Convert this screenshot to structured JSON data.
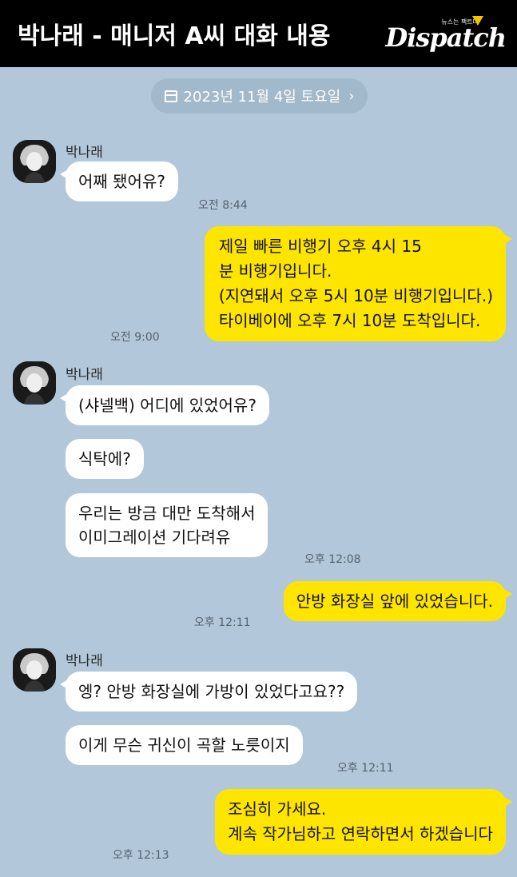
{
  "header": {
    "title": "박나래 - 매니저 A씨 대화 내용",
    "logo_tag": "뉴스는 팩트다",
    "logo_text": "Dispatch"
  },
  "date_pill": {
    "label": "2023년 11월 4일 토요일",
    "icon": "calendar-icon",
    "chevron": "›"
  },
  "messages": [
    {
      "sender": "박나래",
      "text": "어째 됐어유?",
      "time": "오전 8:44"
    },
    {
      "text_lines": [
        "제일 빠른 비행기 오후 4시 15",
        "분 비행기입니다.",
        "(지연돼서 오후 5시 10분 비행기입니다.)",
        "타이베이에 오후 7시 10분 도착입니다."
      ],
      "time": "오전 9:00"
    },
    {
      "sender": "박나래",
      "text": "(샤넬백) 어디에 있었어유?"
    },
    {
      "text": "식탁에?"
    },
    {
      "text_lines": [
        "우리는 방금 대만 도착해서",
        "이미그레이션 기다려유"
      ],
      "time": "오후 12:08"
    },
    {
      "text": "안방 화장실 앞에 있었습니다.",
      "time": "오후 12:11"
    },
    {
      "sender": "박나래",
      "text": "엥? 안방 화장실에 가방이 있었다고요??"
    },
    {
      "text": "이게 무슨 귀신이 곡할 노릇이지",
      "time": "오후 12:11"
    },
    {
      "text_lines": [
        "조심히 가세요.",
        "계속 작가님하고 연락하면서 하겠습니다"
      ],
      "time": "오후 12:13"
    }
  ],
  "colors": {
    "background": "#b2c7d9",
    "outgoing": "#fee500",
    "incoming": "#ffffff",
    "header": "#000000"
  }
}
